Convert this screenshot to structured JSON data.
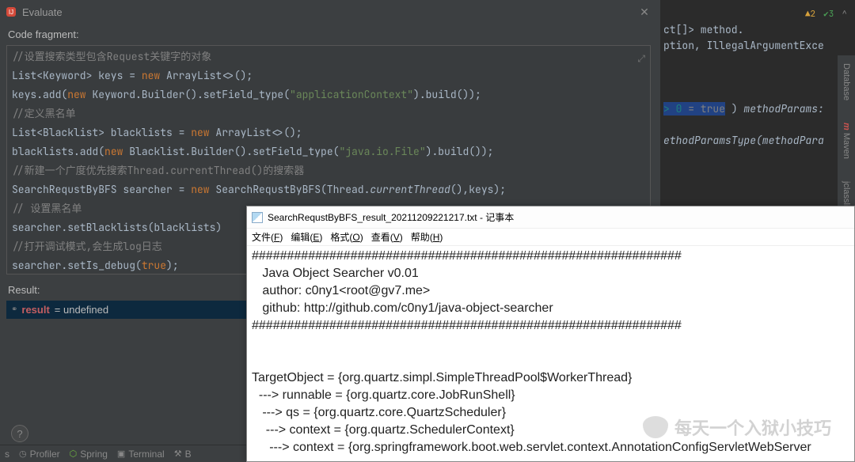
{
  "dialog": {
    "title": "Evaluate",
    "fragment_label": "Code fragment:",
    "result_label": "Result:",
    "result_var": "result",
    "result_value": "= undefined",
    "code_lines": {
      "l1_comment": "//设置搜索类型包含Request关键字的对象",
      "l2_a": "List<Keyword> keys = ",
      "l2_new": "new",
      "l2_b": " ArrayList<>();",
      "l3_a": "keys.add(",
      "l3_new": "new",
      "l3_b": " Keyword.Builder().setField_type(",
      "l3_str": "\"applicationContext\"",
      "l3_c": ").build());",
      "l4_comment": "//定义黑名单",
      "l5_a": "List<Blacklist> blacklists = ",
      "l5_new": "new",
      "l5_b": " ArrayList<>();",
      "l6_a": "blacklists.add(",
      "l6_new": "new",
      "l6_b": " Blacklist.Builder().setField_type(",
      "l6_str": "\"java.io.File\"",
      "l6_c": ").build());",
      "l7_comment": "//新建一个广度优先搜索Thread.currentThread()的搜索器",
      "l8_a": "SearchRequstByBFS searcher = ",
      "l8_new": "new",
      "l8_b": " SearchRequstByBFS(Thread.",
      "l8_m": "currentThread",
      "l8_c": "(),keys);",
      "l9_comment": "// 设置黑名单",
      "l10": "searcher.setBlacklists(blacklists)",
      "l11_comment": "//打开调试模式,会生成log日志",
      "l12_a": "searcher.setIs_debug(",
      "l12_true": "true",
      "l12_b": ");",
      "l13_comment": "//"
    }
  },
  "back": {
    "warn_count": "2",
    "ok_count": "3",
    "line1_a": "ct[]> method.",
    "line2": "ption, IllegalArgumentExce",
    "line4_a": "> 0",
    "line4_b": " = true",
    "line4_c": " )    ",
    "line4_d": "methodParams:",
    "line5": "ethodParamsType(methodPara"
  },
  "sidetabs": {
    "database": "Database",
    "maven": "Maven",
    "jclass": "jclasslib"
  },
  "bottom": {
    "tab1": "s",
    "tab2": "Profiler",
    "tab3": "Spring",
    "tab4": "Terminal",
    "tab5": "B"
  },
  "notepad": {
    "title": "SearchRequstByBFS_result_20211209221217.txt - 记事本",
    "menu": {
      "file": "文件(F)",
      "edit": "编辑(E)",
      "format": "格式(O)",
      "view": "查看(V)",
      "help": "帮助(H)"
    },
    "body": {
      "hr": "#############################################################",
      "l1": "   Java Object Searcher v0.01",
      "l2": "   author: c0ny1<root@gv7.me>",
      "l3": "   github: http://github.com/c0ny1/java-object-searcher",
      "blank": "",
      "t1": "TargetObject = {org.quartz.simpl.SimpleThreadPool$WorkerThread}",
      "t2": "  ---> runnable = {org.quartz.core.JobRunShell}",
      "t3": "   ---> qs = {org.quartz.core.QuartzScheduler}",
      "t4": "    ---> context = {org.quartz.SchedulerContext}",
      "t5": "     ---> context = {org.springframework.boot.web.servlet.context.AnnotationConfigServletWebServer"
    }
  },
  "watermark": "每天一个入狱小技巧"
}
